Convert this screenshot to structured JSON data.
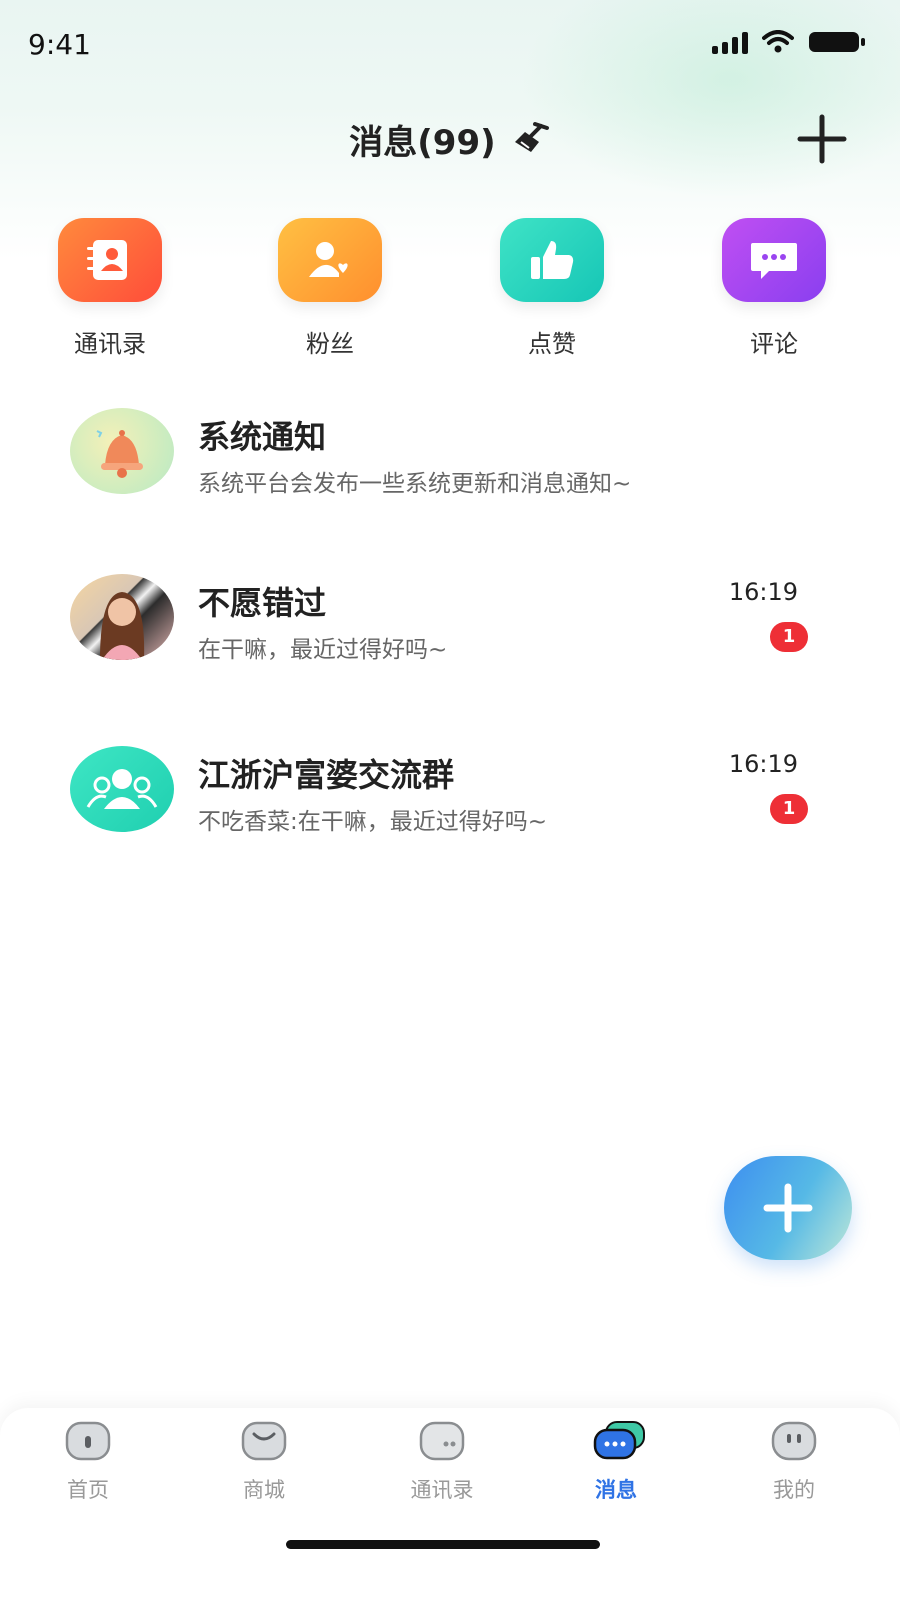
{
  "status_bar": {
    "time": "9:41"
  },
  "header": {
    "title": "消息(99)"
  },
  "quick_actions": [
    {
      "label": "通讯录",
      "icon": "contacts-book-icon",
      "color": "#ff6a3d"
    },
    {
      "label": "粉丝",
      "icon": "fans-icon",
      "color": "#ffa63a"
    },
    {
      "label": "点赞",
      "icon": "thumbs-up-icon",
      "color": "#2fd7c0"
    },
    {
      "label": "评论",
      "icon": "comment-icon",
      "color": "#a444f0"
    }
  ],
  "messages": [
    {
      "title": "系统通知",
      "preview": "系统平台会发布一些系统更新和消息通知~",
      "time": "",
      "badge": "",
      "avatar": "bell-icon"
    },
    {
      "title": "不愿错过",
      "preview": "在干嘛，最近过得好吗~",
      "time": "16:19",
      "badge": "1",
      "avatar": "user-photo"
    },
    {
      "title": "江浙沪富婆交流群",
      "preview": "不吃香菜:在干嘛，最近过得好吗~",
      "time": "16:19",
      "badge": "1",
      "avatar": "group-icon"
    }
  ],
  "bottom_nav": [
    {
      "label": "首页",
      "icon": "home-icon",
      "active": false
    },
    {
      "label": "商城",
      "icon": "shop-icon",
      "active": false
    },
    {
      "label": "通讯录",
      "icon": "contacts-icon",
      "active": false
    },
    {
      "label": "消息",
      "icon": "message-icon",
      "active": true
    },
    {
      "label": "我的",
      "icon": "profile-icon",
      "active": false
    }
  ],
  "colors": {
    "accent": "#2f73e5",
    "badge": "#ee2f36",
    "text_primary": "#222222",
    "text_secondary": "#666666"
  }
}
